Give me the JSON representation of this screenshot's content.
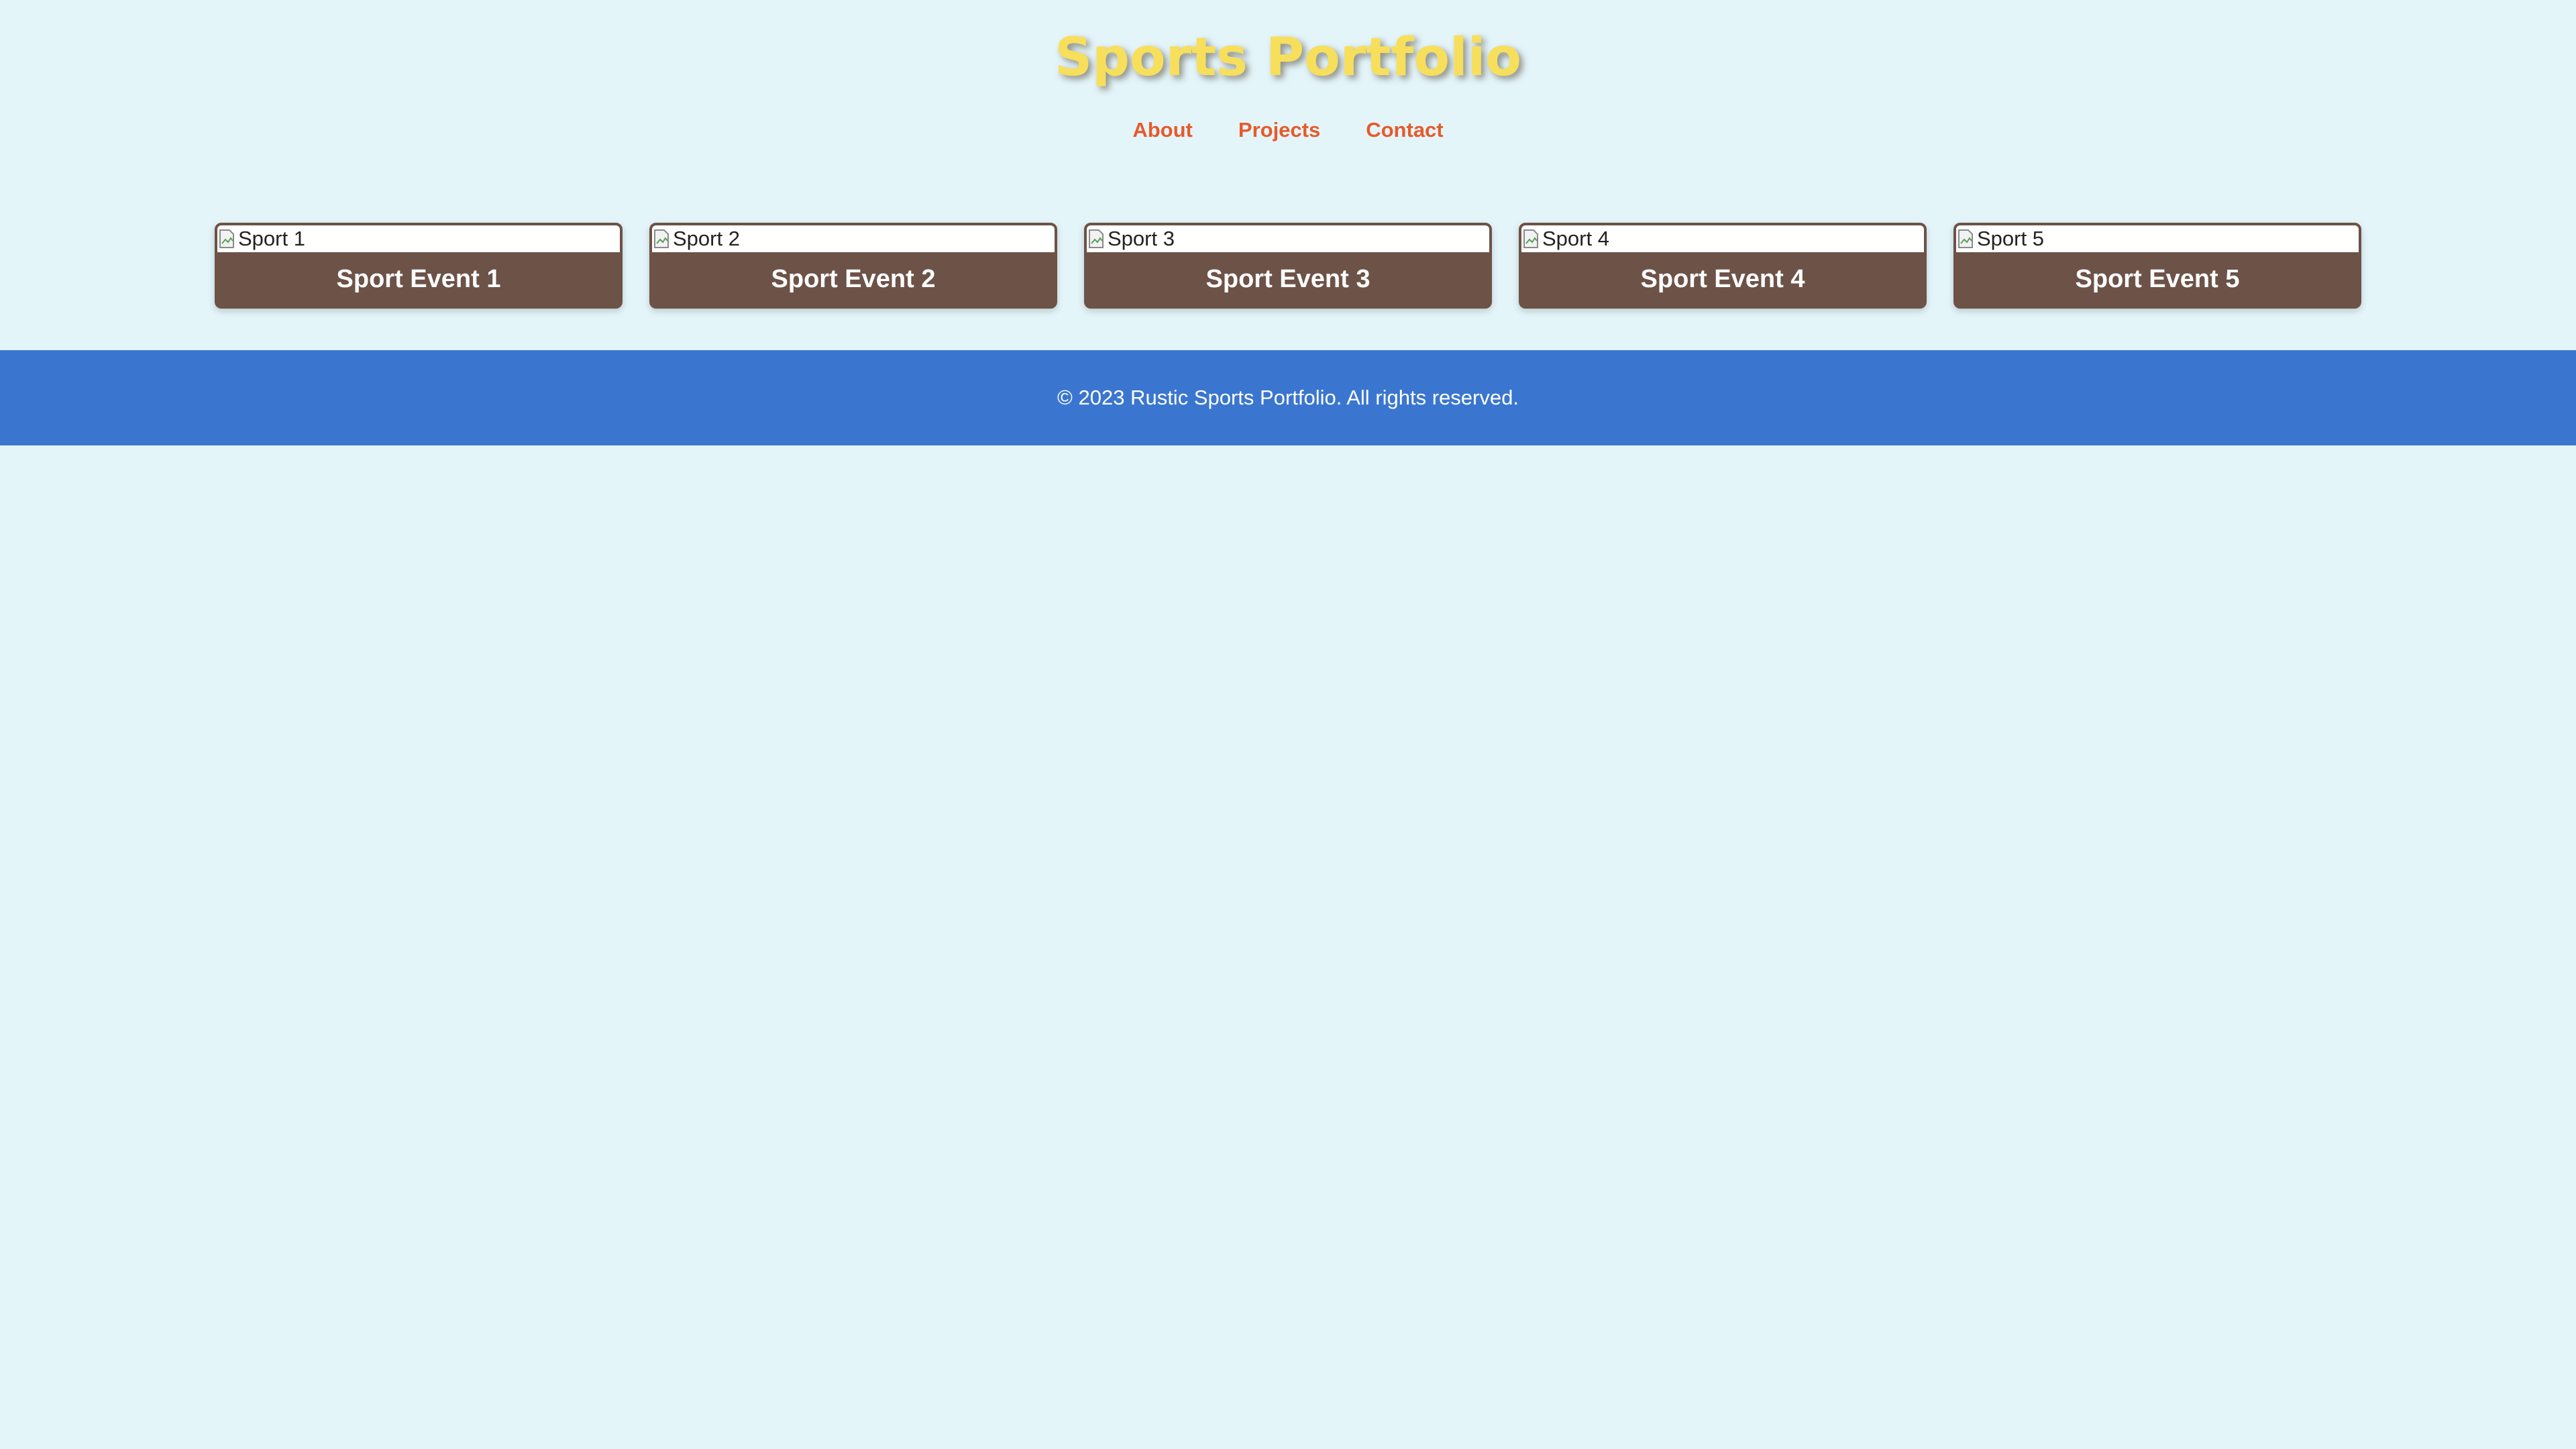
{
  "header": {
    "title": "Sports Portfolio",
    "nav": [
      {
        "label": "About"
      },
      {
        "label": "Projects"
      },
      {
        "label": "Contact"
      }
    ]
  },
  "gallery": {
    "items": [
      {
        "image_alt": "Sport 1",
        "title": "Sport Event 1"
      },
      {
        "image_alt": "Sport 2",
        "title": "Sport Event 2"
      },
      {
        "image_alt": "Sport 3",
        "title": "Sport Event 3"
      },
      {
        "image_alt": "Sport 4",
        "title": "Sport Event 4"
      },
      {
        "image_alt": "Sport 5",
        "title": "Sport Event 5"
      }
    ]
  },
  "footer": {
    "text": "© 2023 Rustic Sports Portfolio. All rights reserved."
  },
  "colors": {
    "background": "#e4f5fa",
    "title": "#f7df5c",
    "nav_link": "#e55b2b",
    "card": "#6d5248",
    "footer": "#3a76cf"
  }
}
